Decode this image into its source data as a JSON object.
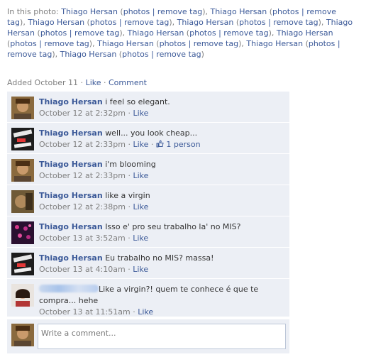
{
  "tags": {
    "prefix": "In this photo:",
    "person": "Thiago Hersan",
    "photos": "photos",
    "separator": "|",
    "remove": "remove tag"
  },
  "meta": {
    "added": "Added October 11",
    "dot1": "·",
    "like": "Like",
    "dot2": "·",
    "comment": "Comment"
  },
  "comments": [
    {
      "author": "Thiago Hersan",
      "text": "i feel so elegant.",
      "time": "October 12 at 2:32pm",
      "like": "Like"
    },
    {
      "author": "Thiago Hersan",
      "text": "well... you look cheap...",
      "time": "October 12 at 2:33pm",
      "like": "Like",
      "likes": "1 person"
    },
    {
      "author": "Thiago Hersan",
      "text": "i'm blooming",
      "time": "October 12 at 2:33pm",
      "like": "Like"
    },
    {
      "author": "Thiago Hersan",
      "text": "like a virgin",
      "time": "October 12 at 2:38pm",
      "like": "Like"
    },
    {
      "author": "Thiago Hersan",
      "text": "Isso e' pro seu trabalho la' no MIS?",
      "time": "October 13 at 3:52am",
      "like": "Like"
    },
    {
      "author": "Thiago Hersan",
      "text": "Eu trabalho no MIS? massa!",
      "time": "October 13 at 4:10am",
      "like": "Like"
    },
    {
      "author": "",
      "text": "Like a virgin?! quem te conhece é que te compra... hehe",
      "time": "October 13 at 11:51am",
      "like": "Like"
    }
  ],
  "compose": {
    "placeholder": "Write a comment..."
  },
  "colors": {
    "link": "#3b5998",
    "comment_bg": "#eceff5",
    "muted": "#808080"
  }
}
